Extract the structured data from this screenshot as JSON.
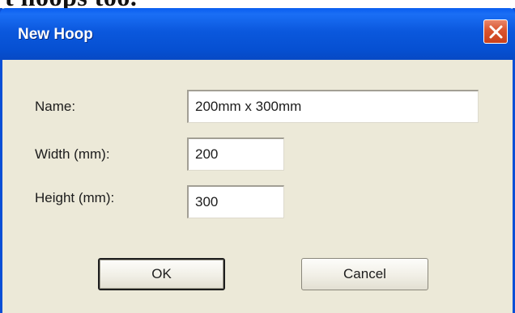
{
  "caption_fragment": "t hoops too.",
  "dialog": {
    "title": "New Hoop",
    "close_icon": "close-x-icon",
    "accent_color": "#0a58dd",
    "close_color": "#d9542e"
  },
  "form": {
    "name_label": "Name:",
    "name_value": "200mm x 300mm",
    "width_label": "Width (mm):",
    "width_value": "200",
    "height_label": "Height (mm):",
    "height_value": "300"
  },
  "buttons": {
    "ok_label": "OK",
    "cancel_label": "Cancel"
  }
}
